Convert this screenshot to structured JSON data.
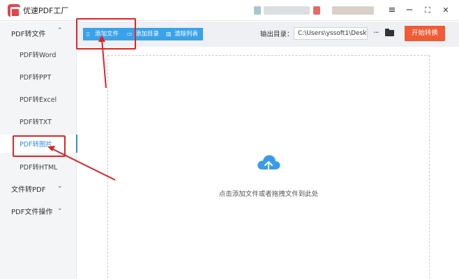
{
  "app": {
    "title": "优速PDF工厂"
  },
  "window_controls": {
    "menu": "≡",
    "minimize": "−",
    "maximize": "⛶",
    "close": "✕"
  },
  "sidebar": {
    "groups": [
      {
        "label": "PDF转文件",
        "chevron": "⌃"
      },
      {
        "label": "文件转PDF",
        "chevron": "⌄"
      },
      {
        "label": "PDF文件操作",
        "chevron": "⌄"
      }
    ],
    "items": [
      {
        "label": "PDF转Word"
      },
      {
        "label": "PDF转PPT"
      },
      {
        "label": "PDF转Excel"
      },
      {
        "label": "PDF转TXT"
      },
      {
        "label": "PDF转图片",
        "active": true
      },
      {
        "label": "PDF转HTML"
      }
    ]
  },
  "toolbar": {
    "add_file": "添加文件",
    "add_folder": "添加目录",
    "clear_list": "清除列表",
    "output_label": "输出目录：",
    "output_path": "C:\\Users\\yssoft1\\Deskt",
    "more": "···",
    "start": "开始转换"
  },
  "main": {
    "drop_hint": "点击添加文件或者拖拽文件到此处"
  },
  "colors": {
    "accent_blue": "#3aa2ea",
    "start_orange": "#f05a35",
    "annotation_red": "#e02424",
    "brand_red": "#e8434b"
  }
}
